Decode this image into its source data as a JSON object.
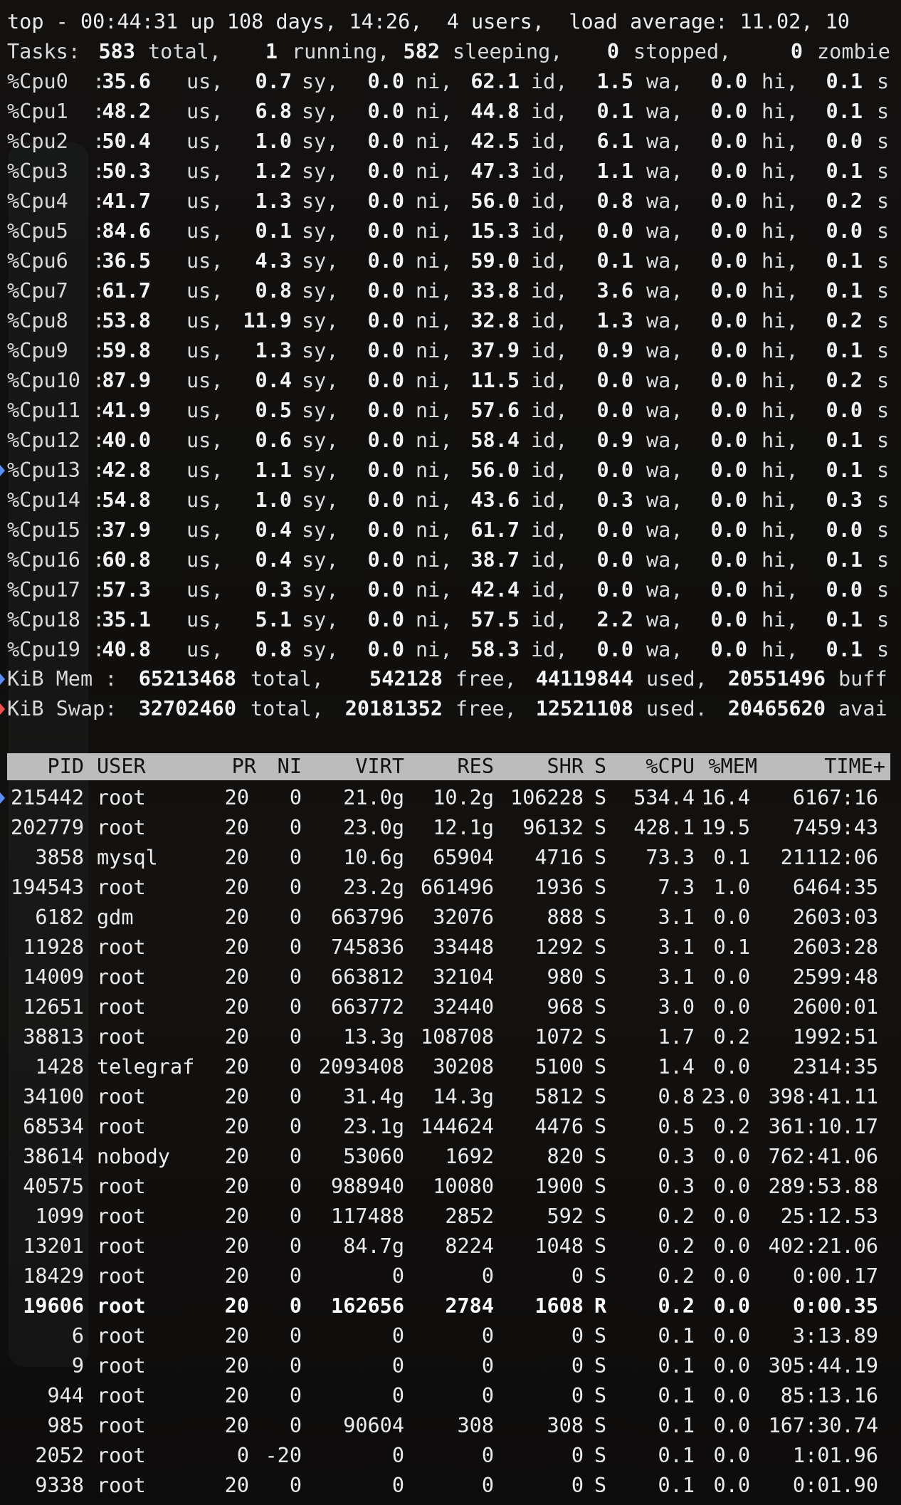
{
  "summary": {
    "line1": "top - 00:44:31 up 108 days, 14:26,  4 users,  load average: 11.02, 10",
    "tasks": {
      "label": "Tasks:",
      "total": "583",
      "total_lbl": "total,",
      "running": "1",
      "running_lbl": "running,",
      "sleeping": "582",
      "sleeping_lbl": "sleeping,",
      "stopped": "0",
      "stopped_lbl": "stopped,",
      "zombie": "0",
      "zombie_lbl": "zombie"
    }
  },
  "cpus": [
    {
      "name": "%Cpu0  :",
      "us": "35.6",
      "sy": "0.7",
      "ni": "0.0",
      "id": "62.1",
      "wa": "1.5",
      "hi": "0.0",
      "si": "0.1"
    },
    {
      "name": "%Cpu1  :",
      "us": "48.2",
      "sy": "6.8",
      "ni": "0.0",
      "id": "44.8",
      "wa": "0.1",
      "hi": "0.0",
      "si": "0.1"
    },
    {
      "name": "%Cpu2  :",
      "us": "50.4",
      "sy": "1.0",
      "ni": "0.0",
      "id": "42.5",
      "wa": "6.1",
      "hi": "0.0",
      "si": "0.0"
    },
    {
      "name": "%Cpu3  :",
      "us": "50.3",
      "sy": "1.2",
      "ni": "0.0",
      "id": "47.3",
      "wa": "1.1",
      "hi": "0.0",
      "si": "0.1"
    },
    {
      "name": "%Cpu4  :",
      "us": "41.7",
      "sy": "1.3",
      "ni": "0.0",
      "id": "56.0",
      "wa": "0.8",
      "hi": "0.0",
      "si": "0.2"
    },
    {
      "name": "%Cpu5  :",
      "us": "84.6",
      "sy": "0.1",
      "ni": "0.0",
      "id": "15.3",
      "wa": "0.0",
      "hi": "0.0",
      "si": "0.0"
    },
    {
      "name": "%Cpu6  :",
      "us": "36.5",
      "sy": "4.3",
      "ni": "0.0",
      "id": "59.0",
      "wa": "0.1",
      "hi": "0.0",
      "si": "0.1"
    },
    {
      "name": "%Cpu7  :",
      "us": "61.7",
      "sy": "0.8",
      "ni": "0.0",
      "id": "33.8",
      "wa": "3.6",
      "hi": "0.0",
      "si": "0.1"
    },
    {
      "name": "%Cpu8  :",
      "us": "53.8",
      "sy": "11.9",
      "ni": "0.0",
      "id": "32.8",
      "wa": "1.3",
      "hi": "0.0",
      "si": "0.2"
    },
    {
      "name": "%Cpu9  :",
      "us": "59.8",
      "sy": "1.3",
      "ni": "0.0",
      "id": "37.9",
      "wa": "0.9",
      "hi": "0.0",
      "si": "0.1"
    },
    {
      "name": "%Cpu10 :",
      "us": "87.9",
      "sy": "0.4",
      "ni": "0.0",
      "id": "11.5",
      "wa": "0.0",
      "hi": "0.0",
      "si": "0.2"
    },
    {
      "name": "%Cpu11 :",
      "us": "41.9",
      "sy": "0.5",
      "ni": "0.0",
      "id": "57.6",
      "wa": "0.0",
      "hi": "0.0",
      "si": "0.0"
    },
    {
      "name": "%Cpu12 :",
      "us": "40.0",
      "sy": "0.6",
      "ni": "0.0",
      "id": "58.4",
      "wa": "0.9",
      "hi": "0.0",
      "si": "0.1"
    },
    {
      "name": "%Cpu13 :",
      "us": "42.8",
      "sy": "1.1",
      "ni": "0.0",
      "id": "56.0",
      "wa": "0.0",
      "hi": "0.0",
      "si": "0.1"
    },
    {
      "name": "%Cpu14 :",
      "us": "54.8",
      "sy": "1.0",
      "ni": "0.0",
      "id": "43.6",
      "wa": "0.3",
      "hi": "0.0",
      "si": "0.3"
    },
    {
      "name": "%Cpu15 :",
      "us": "37.9",
      "sy": "0.4",
      "ni": "0.0",
      "id": "61.7",
      "wa": "0.0",
      "hi": "0.0",
      "si": "0.0"
    },
    {
      "name": "%Cpu16 :",
      "us": "60.8",
      "sy": "0.4",
      "ni": "0.0",
      "id": "38.7",
      "wa": "0.0",
      "hi": "0.0",
      "si": "0.1"
    },
    {
      "name": "%Cpu17 :",
      "us": "57.3",
      "sy": "0.3",
      "ni": "0.0",
      "id": "42.4",
      "wa": "0.0",
      "hi": "0.0",
      "si": "0.0"
    },
    {
      "name": "%Cpu18 :",
      "us": "35.1",
      "sy": "5.1",
      "ni": "0.0",
      "id": "57.5",
      "wa": "2.2",
      "hi": "0.0",
      "si": "0.1"
    },
    {
      "name": "%Cpu19 :",
      "us": "40.8",
      "sy": "0.8",
      "ni": "0.0",
      "id": "58.3",
      "wa": "0.0",
      "hi": "0.0",
      "si": "0.1"
    }
  ],
  "cpu_labels": {
    "us": "us,",
    "sy": "sy,",
    "ni": "ni,",
    "id": "id,",
    "wa": "wa,",
    "hi": "hi,",
    "si": "s"
  },
  "memory": {
    "label": "KiB Mem :",
    "total": "65213468",
    "total_lbl": "total,",
    "free": "542128",
    "free_lbl": "free,",
    "used": "44119844",
    "used_lbl": "used,",
    "buff": "20551496",
    "buff_lbl": "buff"
  },
  "swap": {
    "label": "KiB Swap:",
    "total": "32702460",
    "total_lbl": "total,",
    "free": "20181352",
    "free_lbl": "free,",
    "used": "12521108",
    "used_lbl": "used.",
    "avail": "20465620",
    "avail_lbl": "avai"
  },
  "process_header": {
    "pid": "PID",
    "user": "USER",
    "pr": "PR",
    "ni": "NI",
    "virt": "VIRT",
    "res": "RES",
    "shr": "SHR",
    "s": "S",
    "cpu": "%CPU",
    "mem": "%MEM",
    "time": "TIME+"
  },
  "processes": [
    {
      "pid": "215442",
      "user": "root",
      "pr": "20",
      "ni": "0",
      "virt": "21.0g",
      "res": "10.2g",
      "shr": "106228",
      "s": "S",
      "cpu": "534.4",
      "mem": "16.4",
      "time": "6167:16"
    },
    {
      "pid": "202779",
      "user": "root",
      "pr": "20",
      "ni": "0",
      "virt": "23.0g",
      "res": "12.1g",
      "shr": "96132",
      "s": "S",
      "cpu": "428.1",
      "mem": "19.5",
      "time": "7459:43"
    },
    {
      "pid": "3858",
      "user": "mysql",
      "pr": "20",
      "ni": "0",
      "virt": "10.6g",
      "res": "65904",
      "shr": "4716",
      "s": "S",
      "cpu": "73.3",
      "mem": "0.1",
      "time": "21112:06"
    },
    {
      "pid": "194543",
      "user": "root",
      "pr": "20",
      "ni": "0",
      "virt": "23.2g",
      "res": "661496",
      "shr": "1936",
      "s": "S",
      "cpu": "7.3",
      "mem": "1.0",
      "time": "6464:35"
    },
    {
      "pid": "6182",
      "user": "gdm",
      "pr": "20",
      "ni": "0",
      "virt": "663796",
      "res": "32076",
      "shr": "888",
      "s": "S",
      "cpu": "3.1",
      "mem": "0.0",
      "time": "2603:03"
    },
    {
      "pid": "11928",
      "user": "root",
      "pr": "20",
      "ni": "0",
      "virt": "745836",
      "res": "33448",
      "shr": "1292",
      "s": "S",
      "cpu": "3.1",
      "mem": "0.1",
      "time": "2603:28"
    },
    {
      "pid": "14009",
      "user": "root",
      "pr": "20",
      "ni": "0",
      "virt": "663812",
      "res": "32104",
      "shr": "980",
      "s": "S",
      "cpu": "3.1",
      "mem": "0.0",
      "time": "2599:48"
    },
    {
      "pid": "12651",
      "user": "root",
      "pr": "20",
      "ni": "0",
      "virt": "663772",
      "res": "32440",
      "shr": "968",
      "s": "S",
      "cpu": "3.0",
      "mem": "0.0",
      "time": "2600:01"
    },
    {
      "pid": "38813",
      "user": "root",
      "pr": "20",
      "ni": "0",
      "virt": "13.3g",
      "res": "108708",
      "shr": "1072",
      "s": "S",
      "cpu": "1.7",
      "mem": "0.2",
      "time": "1992:51"
    },
    {
      "pid": "1428",
      "user": "telegraf",
      "pr": "20",
      "ni": "0",
      "virt": "2093408",
      "res": "30208",
      "shr": "5100",
      "s": "S",
      "cpu": "1.4",
      "mem": "0.0",
      "time": "2314:35"
    },
    {
      "pid": "34100",
      "user": "root",
      "pr": "20",
      "ni": "0",
      "virt": "31.4g",
      "res": "14.3g",
      "shr": "5812",
      "s": "S",
      "cpu": "0.8",
      "mem": "23.0",
      "time": "398:41.11"
    },
    {
      "pid": "68534",
      "user": "root",
      "pr": "20",
      "ni": "0",
      "virt": "23.1g",
      "res": "144624",
      "shr": "4476",
      "s": "S",
      "cpu": "0.5",
      "mem": "0.2",
      "time": "361:10.17"
    },
    {
      "pid": "38614",
      "user": "nobody",
      "pr": "20",
      "ni": "0",
      "virt": "53060",
      "res": "1692",
      "shr": "820",
      "s": "S",
      "cpu": "0.3",
      "mem": "0.0",
      "time": "762:41.06"
    },
    {
      "pid": "40575",
      "user": "root",
      "pr": "20",
      "ni": "0",
      "virt": "988940",
      "res": "10080",
      "shr": "1900",
      "s": "S",
      "cpu": "0.3",
      "mem": "0.0",
      "time": "289:53.88"
    },
    {
      "pid": "1099",
      "user": "root",
      "pr": "20",
      "ni": "0",
      "virt": "117488",
      "res": "2852",
      "shr": "592",
      "s": "S",
      "cpu": "0.2",
      "mem": "0.0",
      "time": "25:12.53"
    },
    {
      "pid": "13201",
      "user": "root",
      "pr": "20",
      "ni": "0",
      "virt": "84.7g",
      "res": "8224",
      "shr": "1048",
      "s": "S",
      "cpu": "0.2",
      "mem": "0.0",
      "time": "402:21.06"
    },
    {
      "pid": "18429",
      "user": "root",
      "pr": "20",
      "ni": "0",
      "virt": "0",
      "res": "0",
      "shr": "0",
      "s": "S",
      "cpu": "0.2",
      "mem": "0.0",
      "time": "0:00.17"
    },
    {
      "pid": "19606",
      "user": "root",
      "pr": "20",
      "ni": "0",
      "virt": "162656",
      "res": "2784",
      "shr": "1608",
      "s": "R",
      "cpu": "0.2",
      "mem": "0.0",
      "time": "0:00.35"
    },
    {
      "pid": "6",
      "user": "root",
      "pr": "20",
      "ni": "0",
      "virt": "0",
      "res": "0",
      "shr": "0",
      "s": "S",
      "cpu": "0.1",
      "mem": "0.0",
      "time": "3:13.89"
    },
    {
      "pid": "9",
      "user": "root",
      "pr": "20",
      "ni": "0",
      "virt": "0",
      "res": "0",
      "shr": "0",
      "s": "S",
      "cpu": "0.1",
      "mem": "0.0",
      "time": "305:44.19"
    },
    {
      "pid": "944",
      "user": "root",
      "pr": "20",
      "ni": "0",
      "virt": "0",
      "res": "0",
      "shr": "0",
      "s": "S",
      "cpu": "0.1",
      "mem": "0.0",
      "time": "85:13.16"
    },
    {
      "pid": "985",
      "user": "root",
      "pr": "20",
      "ni": "0",
      "virt": "90604",
      "res": "308",
      "shr": "308",
      "s": "S",
      "cpu": "0.1",
      "mem": "0.0",
      "time": "167:30.74"
    },
    {
      "pid": "2052",
      "user": "root",
      "pr": "0",
      "ni": "-20",
      "virt": "0",
      "res": "0",
      "shr": "0",
      "s": "S",
      "cpu": "0.1",
      "mem": "0.0",
      "time": "1:01.96"
    },
    {
      "pid": "9338",
      "user": "root",
      "pr": "20",
      "ni": "0",
      "virt": "0",
      "res": "0",
      "shr": "0",
      "s": "S",
      "cpu": "0.1",
      "mem": "0.0",
      "time": "0:01.90"
    }
  ],
  "colors": {
    "header_bg": "#bcbcbc",
    "marker_blue": "#5b8ff5",
    "marker_red": "#f05050"
  }
}
